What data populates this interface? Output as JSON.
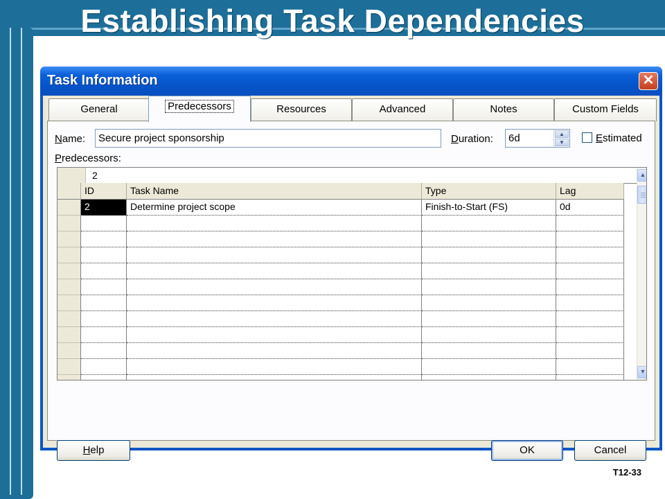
{
  "slide": {
    "title": "Establishing Task Dependencies",
    "slide_id": "T12-33"
  },
  "dialog": {
    "title": "Task Information",
    "close_glyph": "✕",
    "tabs": [
      {
        "label": "General",
        "active": false
      },
      {
        "label": "Predecessors",
        "active": true
      },
      {
        "label": "Resources",
        "active": false
      },
      {
        "label": "Advanced",
        "active": false
      },
      {
        "label": "Notes",
        "active": false
      },
      {
        "label": "Custom Fields",
        "active": false
      }
    ],
    "name_label_first": "N",
    "name_label_rest": "ame:",
    "name_value": "Secure project sponsorship",
    "duration_label_first": "D",
    "duration_label_rest": "uration:",
    "duration_value": "6d",
    "estimated_label_first": "E",
    "estimated_label_rest": "stimated",
    "estimated_checked": false,
    "predecessors_label_first": "P",
    "predecessors_label_rest": "redecessors:",
    "grid": {
      "edit_value": "2",
      "columns": [
        "ID",
        "Task Name",
        "Type",
        "Lag"
      ],
      "rows": [
        {
          "id": "2",
          "task_name": "Determine project scope",
          "type": "Finish-to-Start (FS)",
          "lag": "0d"
        }
      ],
      "empty_rows": 11
    },
    "help_label_first": "H",
    "help_label_rest": "elp",
    "ok_label": "OK",
    "cancel_label": "Cancel"
  },
  "colors": {
    "slide_accent": "#1d6f9a",
    "titlebar": "#0a5fd8",
    "dialog_face": "#ece9d8"
  },
  "icons": {
    "close": "close-icon",
    "spin_up": "spin-up-icon",
    "spin_down": "spin-down-icon",
    "scroll_up": "scroll-up-icon",
    "scroll_down": "scroll-down-icon"
  }
}
